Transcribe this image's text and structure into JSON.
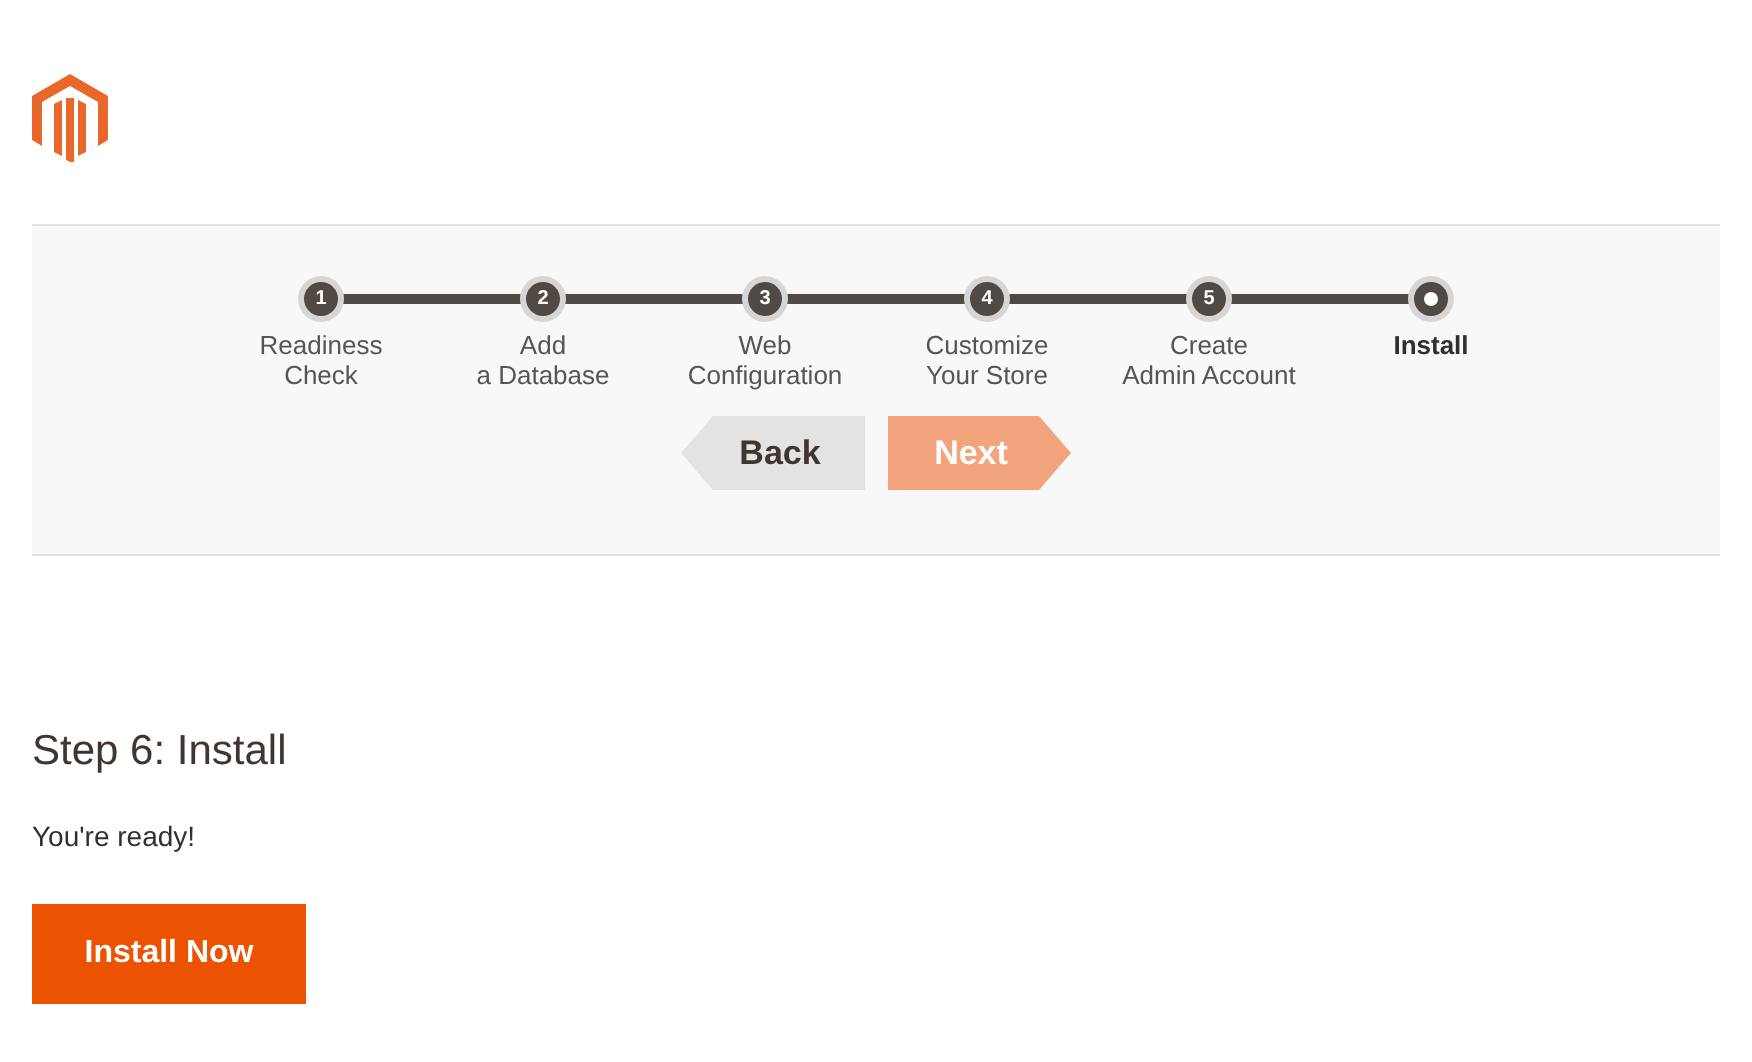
{
  "steps": [
    {
      "number": "1",
      "label": [
        "Readiness",
        "Check"
      ],
      "selected": false
    },
    {
      "number": "2",
      "label": [
        "Add",
        "a Database"
      ],
      "selected": false
    },
    {
      "number": "3",
      "label": [
        "Web",
        "Configuration"
      ],
      "selected": false
    },
    {
      "number": "4",
      "label": [
        "Customize",
        "Your Store"
      ],
      "selected": false
    },
    {
      "number": "5",
      "label": [
        "Create",
        "Admin Account"
      ],
      "selected": false
    },
    {
      "label": [
        "Install"
      ],
      "selected": true
    }
  ],
  "nav_buttons": [
    {
      "kind": "back",
      "label": "Back",
      "disabled": false
    },
    {
      "kind": "next",
      "label": "Next",
      "disabled": true
    }
  ],
  "heading": "Step 6: Install",
  "message": "You're ready!",
  "install_button": "Install Now"
}
